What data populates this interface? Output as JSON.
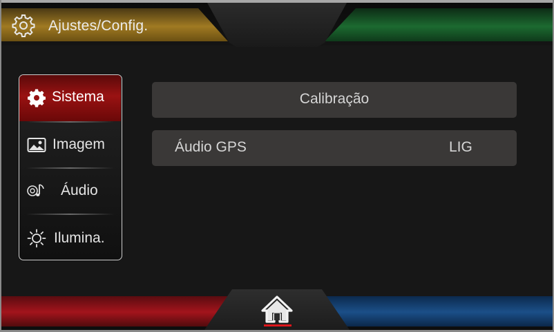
{
  "header": {
    "title": "Ajustes/Config.",
    "icon": "gear-icon"
  },
  "side_menu": {
    "items": [
      {
        "label": "Sistema",
        "icon": "gear-icon",
        "active": true
      },
      {
        "label": "Imagem",
        "icon": "image-icon",
        "active": false
      },
      {
        "label": "Áudio",
        "icon": "audio-icon",
        "active": false
      },
      {
        "label": "Ilumina.",
        "icon": "sun-icon",
        "active": false
      }
    ]
  },
  "content": {
    "rows": [
      {
        "label": "Calibração",
        "value": ""
      },
      {
        "label": "Áudio GPS",
        "value": "LIG"
      }
    ]
  },
  "footer": {
    "home_icon": "home-icon"
  },
  "colors": {
    "active_menu": "#9a1212",
    "header_left": "#a07a22",
    "header_right": "#1c6a30",
    "footer_left": "#a3141c",
    "footer_right": "#1b4f88",
    "home_underline": "#e0161b"
  }
}
